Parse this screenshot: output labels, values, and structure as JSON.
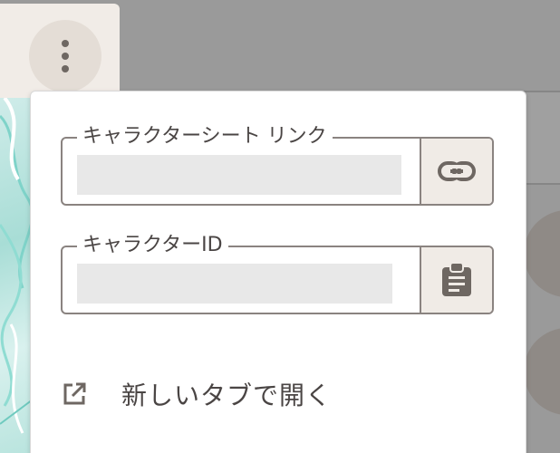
{
  "toolbar": {
    "menu_icon": "more-vertical-icon"
  },
  "popup": {
    "sheet_link": {
      "legend": "キャラクターシート リンク",
      "value": "",
      "button_icon": "link-icon"
    },
    "character_id": {
      "legend": "キャラクターID",
      "value": "",
      "button_icon": "clipboard-icon"
    },
    "open_new_tab": {
      "label": "新しいタブで開く",
      "icon": "open-in-new-icon"
    }
  },
  "colors": {
    "backdrop": "#9a9a9a",
    "card_bg": "#f1ece7",
    "border": "#8a8380",
    "input_fill": "#e8e8e8",
    "icon": "#6e6762",
    "text": "#4a4544"
  }
}
